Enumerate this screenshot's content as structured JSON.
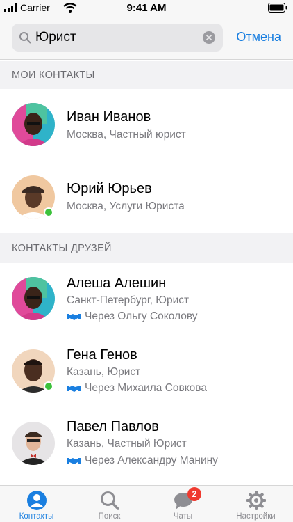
{
  "status_bar": {
    "carrier": "Carrier",
    "time": "9:41 AM"
  },
  "search": {
    "value": "Юрист",
    "cancel_label": "Отмена"
  },
  "sections": {
    "my_contacts": "МОИ КОНТАКТЫ",
    "friends_contacts": "КОНТАКТЫ ДРУЗЕЙ"
  },
  "contacts": [
    {
      "name": "Иван Иванов",
      "subtitle": "Москва, Частный юрист"
    },
    {
      "name": "Юрий Юрьев",
      "subtitle": "Москва, Услуги Юриста",
      "online": true
    }
  ],
  "friend_contacts": [
    {
      "name": "Алеша Алешин",
      "subtitle": "Санкт-Петербург, Юрист",
      "via": "Через Ольгу Соколову"
    },
    {
      "name": "Гена Генов",
      "subtitle": "Казань, Юрист",
      "via": "Через Михаила Совкова",
      "online": true
    },
    {
      "name": "Павел Павлов",
      "subtitle": "Казань, Частный Юрист",
      "via": "Через Александру Манину"
    }
  ],
  "tabs": [
    {
      "label": "Контакты",
      "icon": "person-icon",
      "active": true
    },
    {
      "label": "Поиск",
      "icon": "search-icon"
    },
    {
      "label": "Чаты",
      "icon": "chat-icon",
      "badge": "2"
    },
    {
      "label": "Настройки",
      "icon": "gear-icon"
    }
  ],
  "colors": {
    "accent": "#1a7fe0",
    "online": "#3cc13b",
    "badge": "#ef3a2f"
  }
}
